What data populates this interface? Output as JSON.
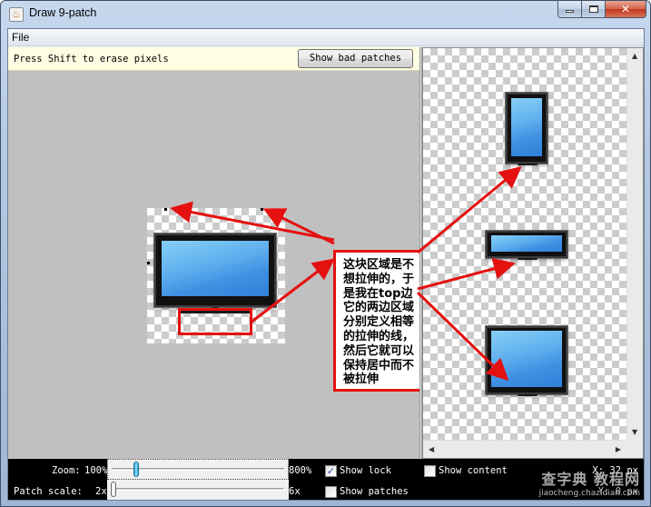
{
  "window": {
    "title": "Draw 9-patch",
    "icon": "java-cup-icon",
    "controls": [
      "minimize",
      "maximize",
      "close"
    ]
  },
  "menubar": {
    "items": [
      "File"
    ]
  },
  "editor": {
    "hint": "Press Shift to erase pixels",
    "show_bad_patches_label": "Show bad patches"
  },
  "annotation": {
    "text": "这块区域是不想拉伸的，于是我在top边它的两边区域分别定义相等的拉伸的线，然后它就可以保持居中而不被拉伸",
    "accent_color": "#e51010"
  },
  "preview": {
    "items": [
      "vertical-stretched-preview",
      "horizontal-stretched-preview",
      "both-stretched-preview"
    ]
  },
  "controls": {
    "zoom": {
      "label": "Zoom:",
      "min_label": "100%",
      "max_label": "800%",
      "value_fraction": 0.13
    },
    "patch_scale": {
      "label": "Patch scale:",
      "min_label": "2x",
      "max_label": "6x",
      "value_fraction": 0.0
    },
    "show_lock": {
      "label": "Show lock",
      "checked": true
    },
    "show_content": {
      "label": "Show content",
      "checked": false
    },
    "show_patches": {
      "label": "Show patches",
      "checked": false
    },
    "x_readout": "X: 32 px",
    "y_readout": "Y: 0 px"
  },
  "watermark": {
    "main": "查字典 教程网",
    "url": "jiaocheng.chazidian.com"
  }
}
